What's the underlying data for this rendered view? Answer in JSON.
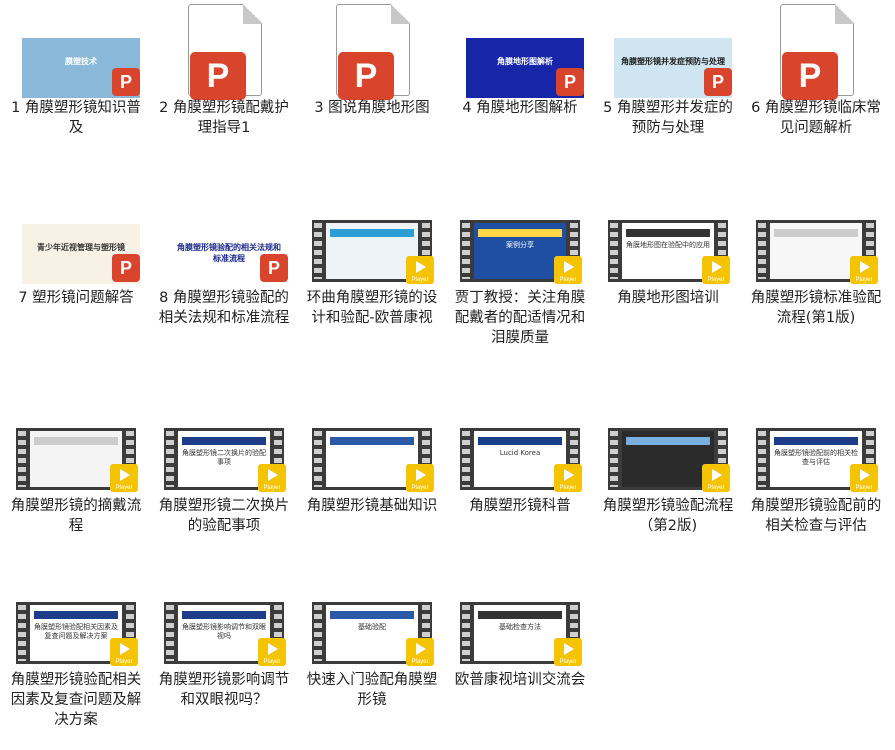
{
  "items": [
    {
      "label": "1 角膜塑形镜知识普及",
      "kind": "slide",
      "bg": "#8ab8d8",
      "accent": "#ffffff",
      "title": "膜塑技术"
    },
    {
      "label": "2 角膜塑形镜配戴护理指导1",
      "kind": "ppt"
    },
    {
      "label": "3 图说角膜地形图",
      "kind": "ppt"
    },
    {
      "label": "4 角膜地形图解析",
      "kind": "slide",
      "bg": "#1726a8",
      "accent": "#ffffff",
      "title": "角膜地形图解析"
    },
    {
      "label": "5 角膜塑形并发症的预防与处理",
      "kind": "slide",
      "bg": "#cfe6f2",
      "accent": "#1a1a1a",
      "title": "角膜塑形镜并发症预防与处理"
    },
    {
      "label": "6 角膜塑形镜临床常见问题解析",
      "kind": "ppt"
    },
    {
      "label": "7 塑形镜问题解答",
      "kind": "slide",
      "bg": "#f7f1e6",
      "accent": "#333333",
      "title": "青少年近视管理与塑形镜"
    },
    {
      "label": "8 角膜塑形镜验配的相关法规和标准流程",
      "kind": "slide",
      "bg": "#ffffff",
      "accent": "#1d2a8a",
      "title": "角膜塑形镜验配的相关法规和标准流程"
    },
    {
      "label": "环曲角膜塑形镜的设计和验配-欧普康视",
      "kind": "video",
      "frame": "#eef3f7",
      "accent": "#2a9fd6"
    },
    {
      "label": "贾丁教授：关注角膜配戴者的配适情况和泪膜质量",
      "kind": "video",
      "frame": "#1e4fa3",
      "accent": "#ffd84a",
      "title": "案例分享"
    },
    {
      "label": "角膜地形图培训",
      "kind": "video",
      "frame": "#ffffff",
      "accent": "#333333",
      "title": "角膜地形图在验配中的应用"
    },
    {
      "label": "角膜塑形镜标准验配流程(第1版)",
      "kind": "video",
      "frame": "#f7f7f7",
      "accent": "#cccccc"
    },
    {
      "label": "角膜塑形镜的摘戴流程",
      "kind": "video",
      "frame": "#f4f4f4",
      "accent": "#cccccc"
    },
    {
      "label": "角膜塑形镜二次换片的验配事项",
      "kind": "video",
      "frame": "#ffffff",
      "accent": "#1d3d8a",
      "title": "角膜塑形镜二次换片的验配事项"
    },
    {
      "label": "角膜塑形镜基础知识",
      "kind": "video",
      "frame": "#ffffff",
      "accent": "#2a5aa8"
    },
    {
      "label": "角膜塑形镜科普",
      "kind": "video",
      "frame": "#ffffff",
      "accent": "#1a3f8a",
      "title": "Lucid Korea"
    },
    {
      "label": "角膜塑形镜验配流程（第2版)",
      "kind": "video",
      "frame": "#2b2b2b",
      "accent": "#7ab0e0"
    },
    {
      "label": "角膜塑形镜验配前的相关检查与评估",
      "kind": "video",
      "frame": "#ffffff",
      "accent": "#1d3d8a",
      "title": "角膜塑形镜验配前的相关检查与评估"
    },
    {
      "label": "角膜塑形镜验配相关因素及复查问题及解决方案",
      "kind": "video",
      "frame": "#ffffff",
      "accent": "#1d3d8a",
      "title": "角膜塑形镜验配相关因素及复查问题及解决方案"
    },
    {
      "label": "角膜塑形镜影响调节和双眼视吗？",
      "kind": "video",
      "frame": "#ffffff",
      "accent": "#1d3d8a",
      "title": "角膜塑形镜影响调节和双眼视吗"
    },
    {
      "label": "快速入门验配角膜塑形镜",
      "kind": "video",
      "frame": "#ffffff",
      "accent": "#2a5aa8",
      "title": "基础验配"
    },
    {
      "label": "欧普康视培训交流会",
      "kind": "video",
      "frame": "#ffffff",
      "accent": "#333333",
      "title": "基础检查方法"
    }
  ],
  "badge": {
    "ppt": "P",
    "player": "Player"
  }
}
